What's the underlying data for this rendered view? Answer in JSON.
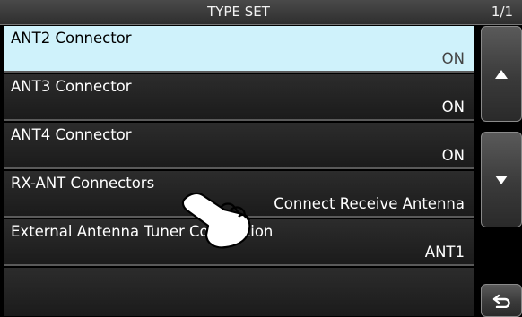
{
  "title_bar": {
    "title": "TYPE SET",
    "page": "1/1"
  },
  "items": [
    {
      "label": "ANT2 Connector",
      "value": "ON",
      "selected": true
    },
    {
      "label": "ANT3 Connector",
      "value": "ON",
      "selected": false
    },
    {
      "label": "ANT4 Connector",
      "value": "ON",
      "selected": false
    },
    {
      "label": "RX-ANT Connectors",
      "value": "Connect Receive Antenna",
      "selected": false
    },
    {
      "label": "External Antenna Tuner Connection",
      "value": "ANT1",
      "selected": false
    }
  ],
  "side_buttons": {
    "up_icon": "up-triangle-icon",
    "down_icon": "down-triangle-icon",
    "return_icon": "return-arrow-icon"
  },
  "colors": {
    "selected_row": "#cff2fb",
    "background": "#000000"
  }
}
